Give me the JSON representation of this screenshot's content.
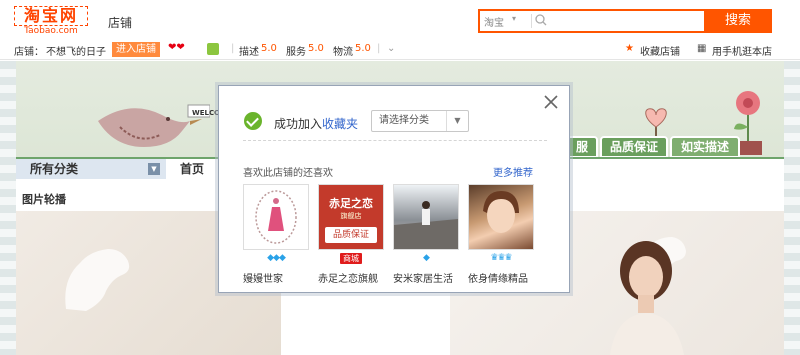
{
  "header": {
    "logo_main": "淘宝网",
    "logo_sub": "Taobao.com",
    "shop_label": "店铺",
    "search": {
      "scope": "淘宝",
      "placeholder": "",
      "button": "搜索"
    }
  },
  "infobar": {
    "shop_prefix": "店铺：",
    "shop_name": "不想飞的日子",
    "enter_button": "进入店铺",
    "score_desc_label": "描述",
    "score_desc": "5.0",
    "score_service_label": "服务",
    "score_service": "5.0",
    "score_ship_label": "物流",
    "score_ship": "5.0",
    "favorite": "收藏店铺",
    "mobile": "用手机逛本店"
  },
  "store": {
    "banner_welcome": "WELCOM",
    "tags": [
      "服",
      "品质保证",
      "如实描述"
    ],
    "nav_all": "所有分类",
    "nav_home": "首页",
    "carousel_title": "图片轮播"
  },
  "dialog": {
    "success_prefix": "成功加入",
    "success_link": "收藏夹",
    "category_select": "请选择分类",
    "also_like": "喜欢此店铺的还喜欢",
    "more": "更多推荐",
    "shops": [
      {
        "name": "嫚嫚世家",
        "level": "◆◆◆",
        "level_type": "diamond"
      },
      {
        "name": "赤足之恋旗舰",
        "level": "商城",
        "level_type": "mall",
        "thumb_title": "赤足之恋",
        "thumb_sub": "旗舰店",
        "thumb_tag": "品质保证"
      },
      {
        "name": "安米家居生活",
        "level": "◆",
        "level_type": "diamond"
      },
      {
        "name": "依身倩缘精品",
        "level": "♛♛♛",
        "level_type": "crown"
      }
    ]
  }
}
